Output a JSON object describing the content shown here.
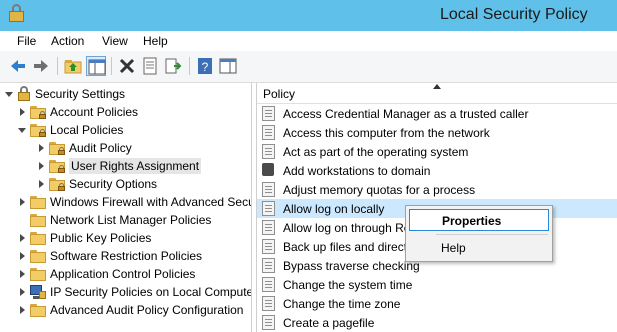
{
  "window": {
    "title": "Local Security Policy"
  },
  "menu": {
    "items": [
      "File",
      "Action",
      "View",
      "Help"
    ]
  },
  "toolbar": {
    "buttons": [
      "back-icon",
      "forward-icon",
      "up-folder-icon",
      "show-hide-tree-icon",
      "delete-icon",
      "properties-icon",
      "export-list-icon",
      "help-icon",
      "show-action-pane-icon"
    ]
  },
  "tree": {
    "root": "Security Settings",
    "items": [
      {
        "label": "Account Policies"
      },
      {
        "label": "Local Policies"
      },
      {
        "label": "Audit Policy"
      },
      {
        "label": "User Rights Assignment"
      },
      {
        "label": "Security Options"
      },
      {
        "label": "Windows Firewall with Advanced Secu"
      },
      {
        "label": "Network List Manager Policies"
      },
      {
        "label": "Public Key Policies"
      },
      {
        "label": "Software Restriction Policies"
      },
      {
        "label": "Application Control Policies"
      },
      {
        "label": "IP Security Policies on Local Compute"
      },
      {
        "label": "Advanced Audit Policy Configuration"
      }
    ]
  },
  "list": {
    "header": "Policy",
    "rows": [
      "Access Credential Manager as a trusted caller",
      "Access this computer from the network",
      "Act as part of the operating system",
      "Add workstations to domain",
      "Adjust memory quotas for a process",
      "Allow log on locally",
      "Allow log on through Re",
      "Back up files and directo",
      "Bypass traverse checking",
      "Change the system time",
      "Change the time zone",
      "Create a pagefile"
    ]
  },
  "context_menu": {
    "items": [
      "Properties",
      "Help"
    ]
  }
}
